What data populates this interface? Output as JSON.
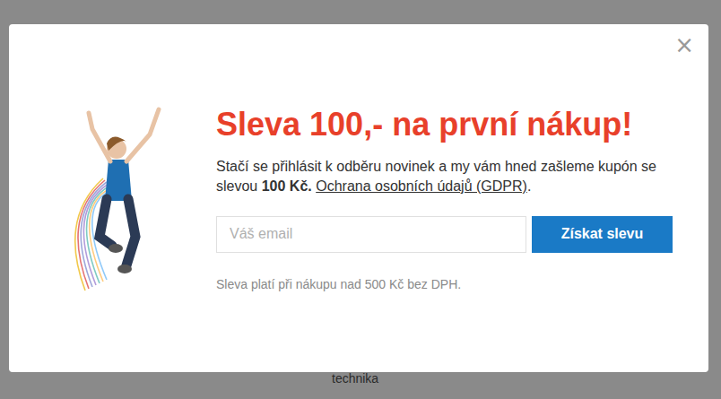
{
  "background": {
    "fragments": [
      "technika"
    ]
  },
  "modal": {
    "close": "×",
    "title": "Sleva 100,- na první nákup!",
    "description": {
      "before": "Stačí se přihlásit k odběru novinek a my vám hned zašleme kupón se slevou ",
      "bold": "100 Kč.",
      "link": "Ochrana osobních údajů (GDPR)",
      "after": "."
    },
    "email": {
      "placeholder": "Váš email"
    },
    "button": "Získat slevu",
    "note": "Sleva platí při nákupu nad 500 Kč bez DPH."
  }
}
